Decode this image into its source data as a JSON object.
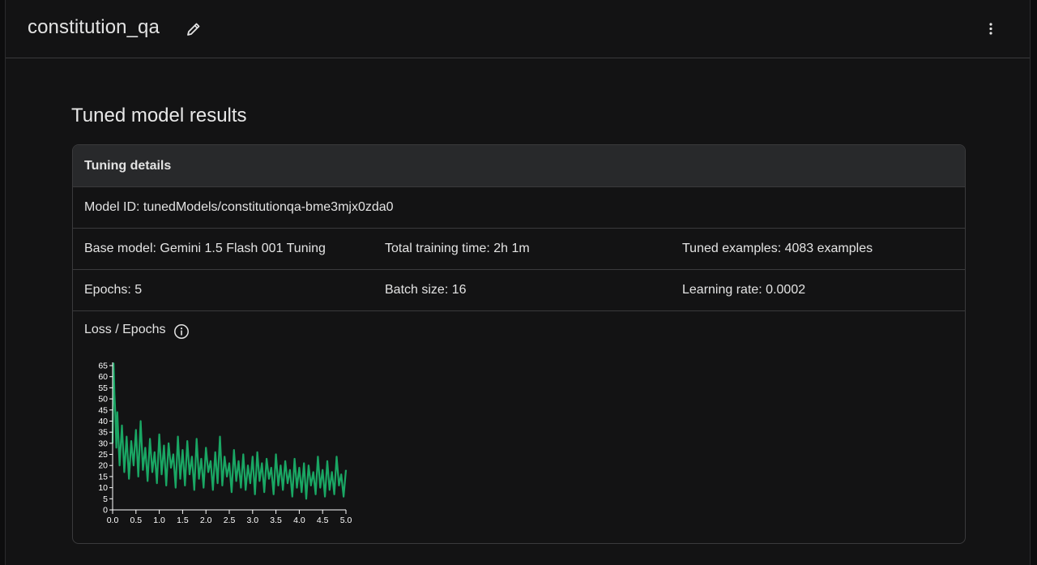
{
  "header": {
    "title": "constitution_qa",
    "edit_icon": "pencil-icon",
    "more_icon": "more-vert-icon"
  },
  "section_title": "Tuned model results",
  "tuning_details": {
    "heading": "Tuning details",
    "model_id": "Model ID: tunedModels/constitutionqa-bme3mjx0zda0",
    "base_model": "Base model: Gemini 1.5 Flash 001 Tuning",
    "total_training_time": "Total training time: 2h 1m",
    "tuned_examples": "Tuned examples: 4083 examples",
    "epochs": "Epochs: 5",
    "batch_size": "Batch size: 16",
    "learning_rate": "Learning rate: 0.0002",
    "loss_label": "Loss / Epochs",
    "info_icon": "info-icon"
  },
  "chart_data": {
    "type": "line",
    "title": "",
    "xlabel": "",
    "ylabel": "",
    "xlim": [
      0,
      5
    ],
    "ylim": [
      0,
      65
    ],
    "x_ticks": [
      "0.0",
      "0.5",
      "1.0",
      "1.5",
      "2.0",
      "2.5",
      "3.0",
      "3.5",
      "4.0",
      "4.5",
      "5.0"
    ],
    "y_ticks": [
      "0",
      "5",
      "10",
      "15",
      "20",
      "25",
      "30",
      "35",
      "40",
      "45",
      "50",
      "55",
      "60",
      "65"
    ],
    "line_color": "#1aa764",
    "grid": false,
    "series": [
      {
        "x": [
          0.0,
          0.02,
          0.04,
          0.06,
          0.08,
          0.1,
          0.15,
          0.2,
          0.25,
          0.3,
          0.35,
          0.4,
          0.45,
          0.5,
          0.55,
          0.6,
          0.65,
          0.7,
          0.75,
          0.8,
          0.85,
          0.9,
          0.95,
          1.0,
          1.05,
          1.1,
          1.15,
          1.2,
          1.25,
          1.3,
          1.35,
          1.4,
          1.45,
          1.5,
          1.55,
          1.6,
          1.65,
          1.7,
          1.75,
          1.8,
          1.85,
          1.9,
          1.95,
          2.0,
          2.05,
          2.1,
          2.15,
          2.2,
          2.25,
          2.3,
          2.35,
          2.4,
          2.45,
          2.5,
          2.55,
          2.6,
          2.65,
          2.7,
          2.75,
          2.8,
          2.85,
          2.9,
          2.95,
          3.0,
          3.05,
          3.1,
          3.15,
          3.2,
          3.25,
          3.3,
          3.35,
          3.4,
          3.45,
          3.5,
          3.55,
          3.6,
          3.65,
          3.7,
          3.75,
          3.8,
          3.85,
          3.9,
          3.95,
          4.0,
          4.05,
          4.1,
          4.15,
          4.2,
          4.25,
          4.3,
          4.35,
          4.4,
          4.45,
          4.5,
          4.55,
          4.6,
          4.65,
          4.7,
          4.75,
          4.8,
          4.85,
          4.9,
          4.95,
          5.0
        ],
        "y": [
          30,
          66,
          52,
          42,
          28,
          44,
          20,
          38,
          17,
          33,
          14,
          31,
          20,
          36,
          15,
          40,
          18,
          28,
          13,
          32,
          17,
          26,
          12,
          34,
          16,
          29,
          11,
          30,
          19,
          25,
          10,
          33,
          14,
          27,
          11,
          31,
          16,
          24,
          9,
          32,
          14,
          23,
          10,
          28,
          17,
          22,
          9,
          26,
          12,
          33,
          11,
          24,
          15,
          21,
          8,
          27,
          13,
          22,
          10,
          25,
          9,
          20,
          12,
          24,
          7,
          26,
          13,
          21,
          8,
          23,
          14,
          19,
          7,
          25,
          11,
          20,
          9,
          22,
          12,
          18,
          6,
          23,
          10,
          19,
          8,
          21,
          5,
          20,
          11,
          17,
          7,
          24,
          10,
          18,
          6,
          22,
          9,
          17,
          7,
          24,
          11,
          16,
          6,
          18
        ]
      }
    ]
  }
}
